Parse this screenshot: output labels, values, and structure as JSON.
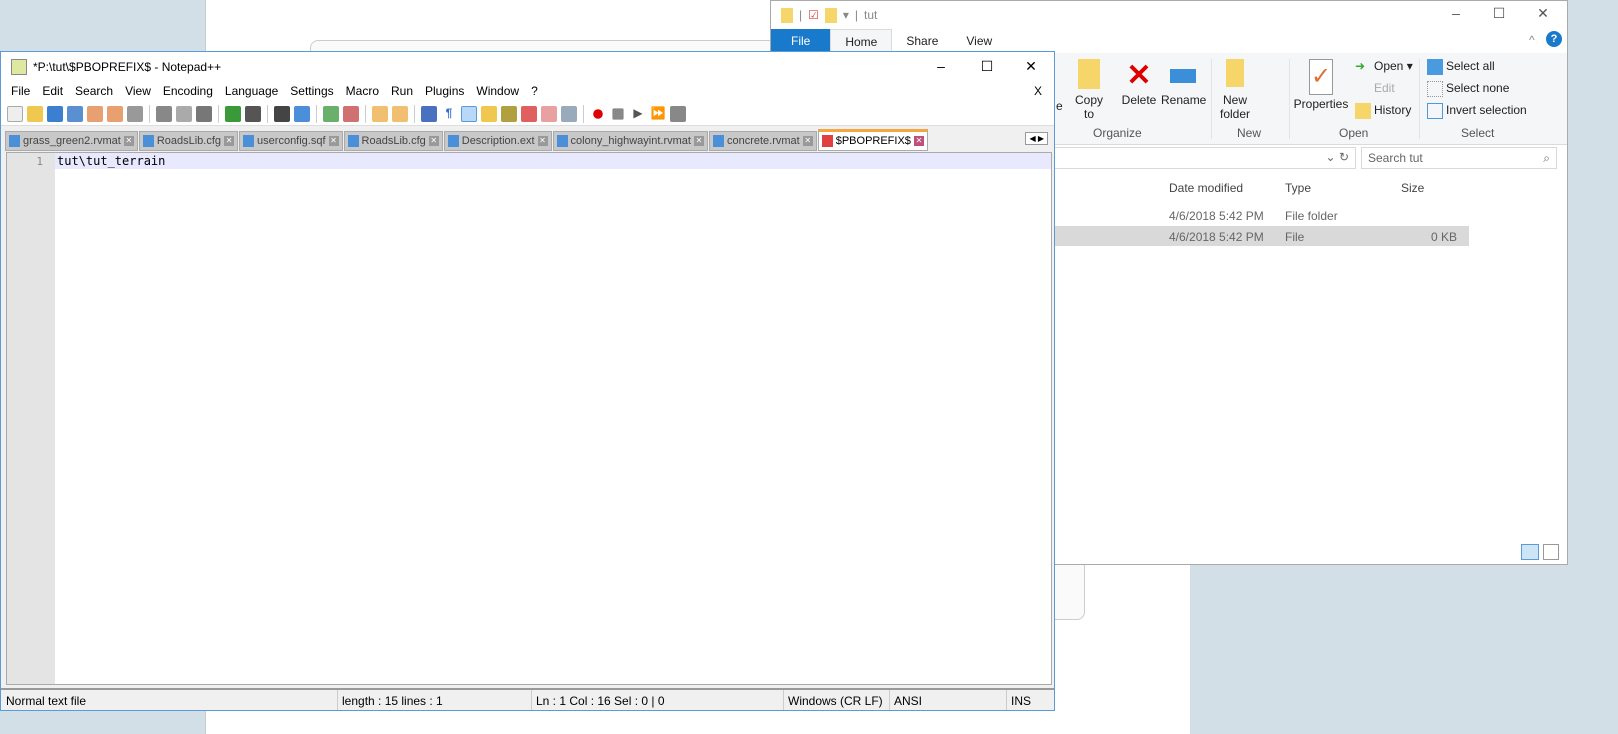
{
  "explorer": {
    "title": "tut",
    "tabs": [
      "File",
      "Home",
      "Share",
      "View"
    ],
    "ribbon": {
      "copy_to": "Copy to",
      "delete": "Delete",
      "rename": "Rename",
      "new_folder": "New folder",
      "properties": "Properties",
      "open": "Open",
      "edit": "Edit",
      "history": "History",
      "select_all": "Select all",
      "select_none": "Select none",
      "invert_selection": "Invert selection",
      "move_partial": "e",
      "groups": [
        "Organize",
        "New",
        "Open",
        "Select"
      ]
    },
    "search_placeholder": "Search tut",
    "columns": [
      "Date modified",
      "Type",
      "Size"
    ],
    "rows": [
      {
        "date": "4/6/2018 5:42 PM",
        "type": "File folder",
        "size": ""
      },
      {
        "date": "4/6/2018 5:42 PM",
        "type": "File",
        "size": "0 KB"
      }
    ]
  },
  "npp": {
    "title": "*P:\\tut\\$PBOPREFIX$ - Notepad++",
    "menu": [
      "File",
      "Edit",
      "Search",
      "View",
      "Encoding",
      "Language",
      "Settings",
      "Macro",
      "Run",
      "Plugins",
      "Window",
      "?"
    ],
    "close_doc": "X",
    "tabs": [
      "grass_green2.rvmat",
      "RoadsLib.cfg",
      "userconfig.sqf",
      "RoadsLib.cfg",
      "Description.ext",
      "colony_highwayint.rvmat",
      "concrete.rvmat",
      "$PBOPREFIX$"
    ],
    "line_number": "1",
    "content": "tut\\tut_terrain",
    "status": {
      "type": "Normal text file",
      "length": "length : 15    lines : 1",
      "pos": "Ln : 1    Col : 16    Sel : 0 | 0",
      "eol": "Windows (CR LF)",
      "enc": "ANSI",
      "mode": "INS"
    }
  }
}
